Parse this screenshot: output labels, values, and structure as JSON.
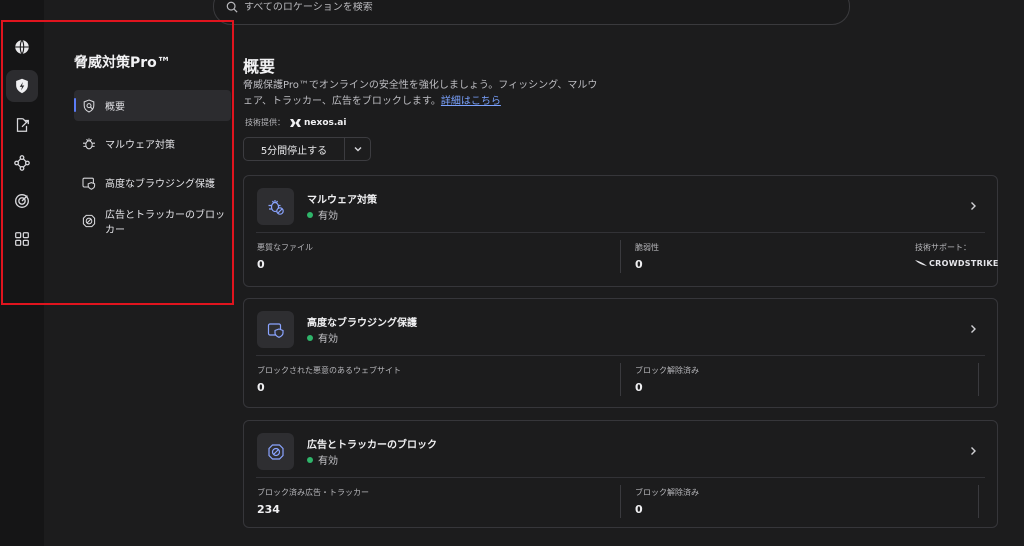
{
  "search": {
    "placeholder": "すべてのロケーションを検索"
  },
  "rail": {
    "items": [
      {
        "icon": "globe-icon"
      },
      {
        "icon": "shield-bolt-icon"
      },
      {
        "icon": "file-export-icon"
      },
      {
        "icon": "mesh-network-icon"
      },
      {
        "icon": "target-radar-icon"
      },
      {
        "icon": "apps-grid-icon"
      }
    ]
  },
  "subnav": {
    "title": "脅威対策Pro™",
    "items": [
      {
        "label": "概要",
        "icon": "shield-search-icon"
      },
      {
        "label": "マルウェア対策",
        "icon": "bug-icon"
      },
      {
        "label": "高度なブラウジング保護",
        "icon": "browser-shield-icon"
      },
      {
        "label": "広告とトラッカーのブロッカー",
        "icon": "block-icon"
      }
    ]
  },
  "main": {
    "title": "概要",
    "description": "脅威保護Pro™でオンラインの安全性を強化しましょう。フィッシング、マルウェア、トラッカー、広告をブロックします。",
    "link": "詳細はこちら",
    "provider_label": "技術提供：",
    "provider_name": "nexos.ai",
    "pause_label": "5分間停止する"
  },
  "cards": [
    {
      "title": "マルウェア対策",
      "status": "有効",
      "stats": [
        {
          "label": "悪質なファイル",
          "value": "0"
        },
        {
          "label": "脆弱性",
          "value": "0"
        }
      ],
      "support_label": "技術サポート：",
      "support_brand": "CROWDSTRIKE"
    },
    {
      "title": "高度なブラウジング保護",
      "status": "有効",
      "stats": [
        {
          "label": "ブロックされた悪意のあるウェブサイト",
          "value": "0"
        },
        {
          "label": "ブロック解除済み",
          "value": "0"
        }
      ]
    },
    {
      "title": "広告とトラッカーのブロック",
      "status": "有効",
      "stats": [
        {
          "label": "ブロック済み広告・トラッカー",
          "value": "234"
        },
        {
          "label": "ブロック解除済み",
          "value": "0"
        }
      ]
    }
  ],
  "colors": {
    "accent": "#5b7cf7",
    "status_ok": "#2fb56a",
    "highlight": "#e0141e"
  }
}
